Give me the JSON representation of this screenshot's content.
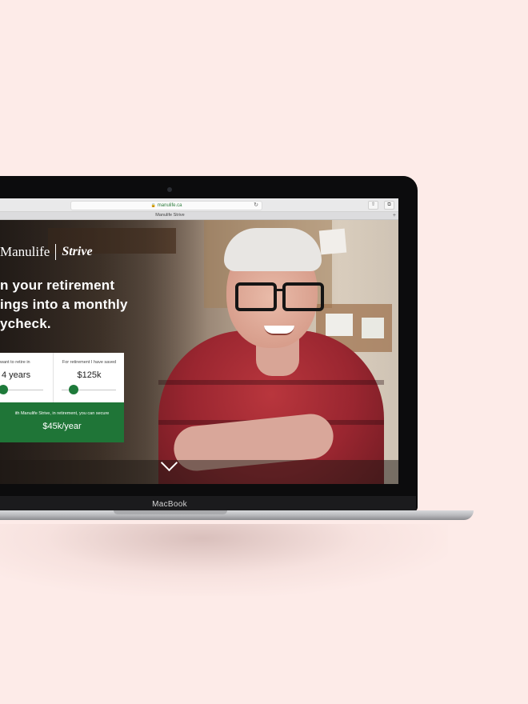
{
  "browser": {
    "url": "manulife.ca",
    "tab_title": "Manulife Strive",
    "reload_icon": "reload-icon",
    "share_icon": "share-icon",
    "tabs_icon": "tabs-icon",
    "new_tab_label": "+"
  },
  "brand": {
    "company": "Manulife",
    "product": "Strive"
  },
  "hero": {
    "headline_lines": [
      "n your retirement",
      "ings into a monthly",
      "ycheck."
    ]
  },
  "calculator": {
    "retire_in_label": "want to retire in",
    "retire_in_value": "4 years",
    "retire_in_slider_level": 0.0,
    "saved_label": "For retirement I have saved",
    "saved_value": "$125k",
    "saved_slider_level": 0.14,
    "result_note": "ith Manulife Strive, in retirement, you can secure",
    "result_amount": "$45k/year"
  },
  "device": {
    "label": "MacBook"
  },
  "colors": {
    "background": "#fdebe8",
    "accent_green": "#1f7537",
    "shirt_red": "#a8303a"
  }
}
